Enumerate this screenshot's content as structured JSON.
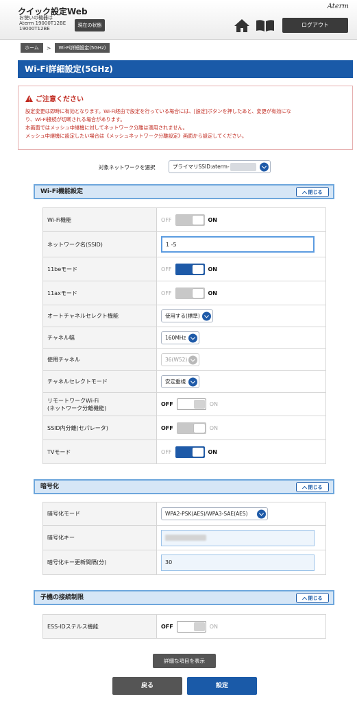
{
  "header": {
    "app_title": "クイック設定Web",
    "device_info": "お使いの機器は\nAterm 19000T12BE\n19000T12BE",
    "status_button": "現在の状態",
    "brand": "Aterm",
    "logout_button": "ログアウト",
    "icons": [
      "home-icon",
      "book-icon"
    ]
  },
  "breadcrumb": {
    "items": [
      "ホーム",
      "Wi-Fi詳細設定(5GHz)"
    ],
    "separator": ">"
  },
  "page_title": "Wi-Fi詳細設定(5GHz)",
  "notice": {
    "title": "ご注意ください",
    "lines": [
      "設定変更は即時に有効となります。Wi-Fi経由で設定を行っている場合には、[設定]ボタンを押したあと、変更が有効にな",
      "り、Wi-Fi接続が切断される場合があります。",
      "本画面ではメッシュ中継機に対してネットワーク分離は適用されません。",
      "メッシュ中継機に設定したい場合は《メッシュネットワーク分離設定》画面から設定してください。"
    ],
    "color": "#c0281e"
  },
  "network_select": {
    "label": "対象ネットワークを選択",
    "value": "プライマリSSID:aterm-"
  },
  "wifi_section": {
    "title": "Wi-Fi機能設定",
    "close_label": "閉じる",
    "rows": [
      {
        "label": "Wi-Fi機能",
        "off": "OFF",
        "on": "ON",
        "state": "on",
        "disabled": true
      },
      {
        "label": "ネットワーク名(SSID)",
        "value": "1     -5"
      },
      {
        "label": "11beモード",
        "off": "OFF",
        "on": "ON",
        "state": "on"
      },
      {
        "label": "11axモード",
        "off": "OFF",
        "on": "ON",
        "state": "on",
        "disabled": true
      },
      {
        "label": "オートチャネルセレクト機能",
        "select": "使用する(標準)"
      },
      {
        "label": "チャネル幅",
        "select": "160MHz"
      },
      {
        "label": "使用チャネル",
        "select": "36(W52)",
        "disabled": true
      },
      {
        "label": "チャネルセレクトモード",
        "select": "安定重視"
      },
      {
        "label": "リモートワークWi-Fi\n(ネットワーク分離機能)",
        "off": "OFF",
        "on": "ON",
        "state": "off"
      },
      {
        "label": "SSID内分離(セパレータ)",
        "off": "OFF",
        "on": "ON",
        "state": "off",
        "disabled": true
      },
      {
        "label": "TVモード",
        "off": "OFF",
        "on": "ON",
        "state": "on"
      }
    ]
  },
  "encryption_section": {
    "title": "暗号化",
    "close_label": "閉じる",
    "mode_label": "暗号化モード",
    "mode_value": "WPA2-PSK(AES)/WPA3-SAE(AES)",
    "key_label": "暗号化キー",
    "key_value": "",
    "interval_label": "暗号化キー更新間隔(分)",
    "interval_value": "30"
  },
  "client_section": {
    "title": "子機の接続制限",
    "close_label": "閉じる",
    "stealth_label": "ESS-IDステルス機能",
    "off": "OFF",
    "on": "ON",
    "state": "off"
  },
  "buttons": {
    "detail": "詳細な項目を表示",
    "back": "戻る",
    "apply": "設定"
  },
  "colors": {
    "accent": "#1a5aa8",
    "section_header_bg": "#d6e6f6",
    "warning": "#c0281e"
  }
}
